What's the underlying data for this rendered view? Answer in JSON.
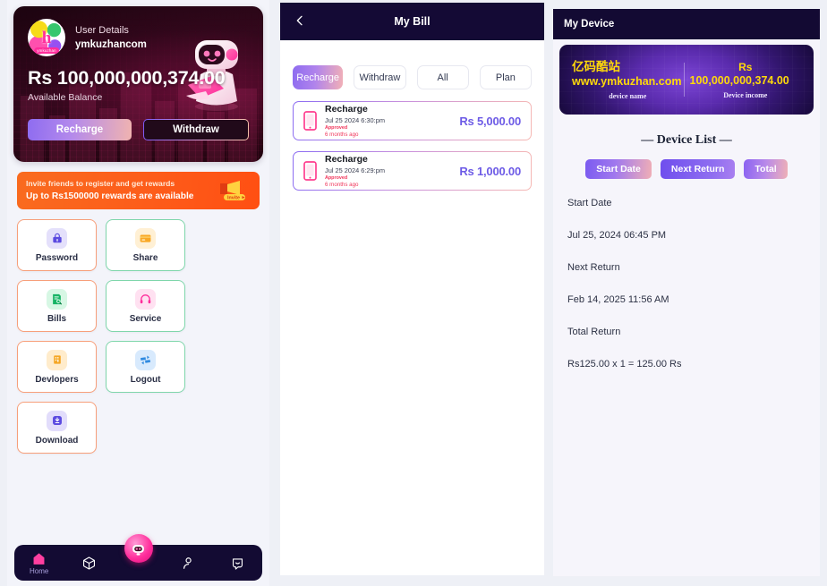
{
  "home": {
    "user": {
      "title": "User Details",
      "name": "ymkuzhancom",
      "avatar_letter": "h",
      "avatar_tag": "ymkuzhan"
    },
    "balance": {
      "amount": "Rs 100,000,000,374.00",
      "label": "Available Balance"
    },
    "actions": {
      "recharge": "Recharge",
      "withdraw": "Withdraw"
    },
    "invite": {
      "line1": "Invite friends to register and get rewards",
      "line2": "Up to Rs1500000 rewards are available",
      "badge": "Invite"
    },
    "menu": [
      {
        "label": "Password",
        "icon": "lock-icon",
        "border": "orange",
        "icon_bg": "#e4e0fb",
        "icon_color": "#5b4ae0"
      },
      {
        "label": "Share",
        "icon": "card-icon",
        "border": "green",
        "icon_bg": "#fff0d4",
        "icon_color": "#f5a623"
      },
      {
        "label": "Bills",
        "icon": "bill-search-icon",
        "border": "orange",
        "icon_bg": "#d7f7e4",
        "icon_color": "#17b365"
      },
      {
        "label": "Service",
        "icon": "headset-icon",
        "border": "green",
        "icon_bg": "#ffe1f1",
        "icon_color": "#ff2d9b"
      },
      {
        "label": "Devlopers",
        "icon": "building-icon",
        "border": "orange",
        "icon_bg": "#ffeccc",
        "icon_color": "#f5a623"
      },
      {
        "label": "Logout",
        "icon": "logout-swap-icon",
        "border": "green",
        "icon_bg": "#d8eafd",
        "icon_color": "#2f8ae0"
      },
      {
        "label": "Download",
        "icon": "download-icon",
        "border": "orange",
        "icon_bg": "#e2ddfb",
        "icon_color": "#5b4ae0"
      }
    ],
    "nav": [
      {
        "label": "Home",
        "icon": "home-icon",
        "active": true
      },
      {
        "label": "",
        "icon": "cube-icon",
        "active": false
      },
      {
        "label": "",
        "icon": "robot-icon",
        "active": false
      },
      {
        "label": "",
        "icon": "user-icon",
        "active": false
      },
      {
        "label": "",
        "icon": "chat-icon",
        "active": false
      }
    ],
    "colors": {
      "accent_pink": "#ff2d9b",
      "accent_purple": "#8e6cf0",
      "nav_bg": "#130b33"
    }
  },
  "bill": {
    "header": {
      "title": "My Bill",
      "back_icon": "chevron-left-icon"
    },
    "filters": [
      {
        "label": "Recharge",
        "active": true
      },
      {
        "label": "Withdraw",
        "active": false
      },
      {
        "label": "All",
        "active": false
      },
      {
        "label": "Plan",
        "active": false
      }
    ],
    "transactions": [
      {
        "type": "Recharge",
        "datetime": "Jul 25 2024 6:30:pm",
        "status": "Approved",
        "relative": "6 months ago",
        "amount": "Rs 5,000.00",
        "icon": "phone-icon"
      },
      {
        "type": "Recharge",
        "datetime": "Jul 25 2024 6:29:pm",
        "status": "Approved",
        "relative": "6 months ago",
        "amount": "Rs 1,000.00",
        "icon": "phone-icon"
      }
    ],
    "colors": {
      "amount": "#6d5be6",
      "status": "#f0365b"
    }
  },
  "device": {
    "header": {
      "title": "My Device"
    },
    "card": {
      "name_cn": "亿码酷站",
      "name_url": "www.ymkuzhan.com",
      "name_label": "device name",
      "income_currency": "Rs",
      "income_amount": "100,000,000,374.00",
      "income_label": "Device income"
    },
    "list_title": "— Device List —",
    "tabs": [
      {
        "label": "Start Date"
      },
      {
        "label": "Next Return"
      },
      {
        "label": "Total"
      }
    ],
    "rows": [
      "Start Date",
      "Jul 25, 2024 06:45 PM",
      "Next Return",
      "Feb 14, 2025 11:56 AM",
      "Total Return",
      "Rs125.00 x 1 = 125.00 Rs"
    ]
  }
}
